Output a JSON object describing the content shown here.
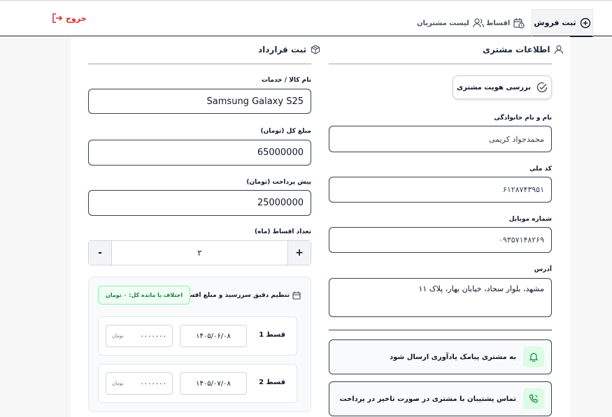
{
  "nav": {
    "logout_label": "خروج",
    "tabs": [
      {
        "label": "ثبت فروش",
        "icon": "plus-circle-icon",
        "active": true
      },
      {
        "label": "اقساط",
        "icon": "calendar-clock-icon",
        "active": false
      },
      {
        "label": "لیست مشتریان",
        "icon": "users-icon",
        "active": false
      }
    ]
  },
  "customer": {
    "title": "اطلاعات مشتری",
    "verify_button": "بررسی هویت مشتری",
    "fields": {
      "name_label": "نام و نام خانوادگی",
      "name_value": "محمدجواد کریمی",
      "national_id_label": "کد ملی",
      "national_id_value": "۶۱۲۸۷۴۳۹۵۱",
      "mobile_label": "شماره موبایل",
      "mobile_value": "۰۹۳۵۷۱۴۸۲۶۹",
      "address_label": "آدرس",
      "address_value": "مشهد، بلوار سجاد، خیابان بهار، پلاک ۱۱"
    },
    "toggles": [
      {
        "label": "به مشتری پیامک یادآوری ارسال شود",
        "icon": "bell-icon"
      },
      {
        "label": "تماس پشتیبان با مشتری در صورت تاخیر در پرداخت",
        "icon": "phone-icon"
      }
    ]
  },
  "contract": {
    "title": "ثبت قرارداد",
    "product_label": "نام کالا / خدمات",
    "product_value": "Samsung Galaxy S25",
    "total_label": "مبلغ کل (تومان)",
    "total_value": "65000000",
    "prepay_label": "پیش پرداخت (تومان)",
    "prepay_value": "25000000",
    "count_label": "تعداد اقساط (ماه)",
    "count_value": "۲",
    "minus": "-",
    "plus": "+",
    "schedule_title": "تنظیم دقیق سررسید و مبلغ اقساط",
    "diff_badge": "اختلاف با مانده کل: ۰ تومان",
    "installments": [
      {
        "label": "قسط 1",
        "date": "۱۴۰۵/۰۶/۰۸",
        "amount": "۰۰۰۰۰۰۰",
        "unit": "تومان"
      },
      {
        "label": "قسط 2",
        "date": "۱۴۰۵/۰۷/۰۸",
        "amount": "۰۰۰۰۰۰۰",
        "unit": "تومان"
      }
    ]
  },
  "colors": {
    "logout": "#dc2626",
    "badge_green": "#15803d",
    "toggle_icon_bg": "#dcfce7",
    "border_dark": "#374151"
  }
}
